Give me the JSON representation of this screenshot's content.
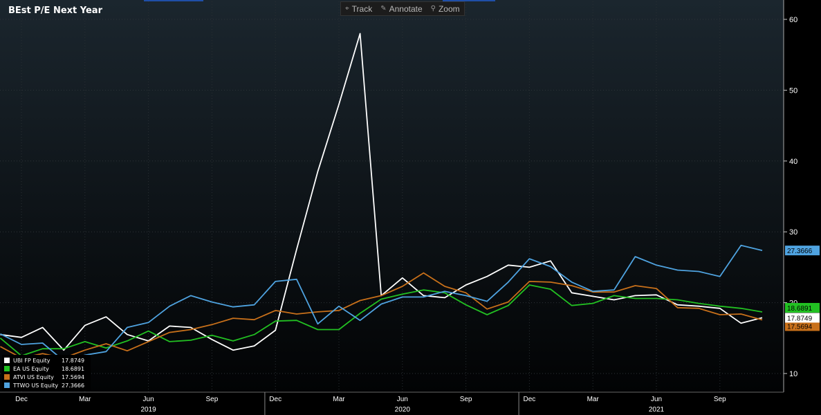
{
  "chart_data": {
    "type": "line",
    "title": "BEst P/E Next Year",
    "ylim": [
      8,
      62
    ],
    "y_ticks": [
      10,
      20,
      30,
      40,
      50,
      60
    ],
    "x_ticks": [
      {
        "label": "Dec",
        "x": 0
      },
      {
        "label": "Mar",
        "x": 3
      },
      {
        "label": "Jun",
        "x": 6
      },
      {
        "label": "Sep",
        "x": 9
      },
      {
        "label": "Dec",
        "x": 12
      },
      {
        "label": "Mar",
        "x": 15
      },
      {
        "label": "Jun",
        "x": 18
      },
      {
        "label": "Sep",
        "x": 21
      },
      {
        "label": "Dec",
        "x": 24
      },
      {
        "label": "Mar",
        "x": 27
      },
      {
        "label": "Jun",
        "x": 30
      },
      {
        "label": "Sep",
        "x": 33
      }
    ],
    "year_labels": [
      {
        "label": "2019",
        "x": 6
      },
      {
        "label": "2020",
        "x": 18
      },
      {
        "label": "2021",
        "x": 30
      }
    ],
    "x": [
      -1,
      0,
      1,
      2,
      3,
      4,
      5,
      6,
      7,
      8,
      9,
      10,
      11,
      12,
      13,
      14,
      15,
      16,
      17,
      18,
      19,
      20,
      21,
      22,
      23,
      24,
      25,
      26,
      27,
      28,
      29,
      30,
      31,
      32,
      33,
      34,
      35
    ],
    "series": [
      {
        "name": "UBI FP Equity",
        "last": "17.8749",
        "color": "#ffffff",
        "values": [
          15.5,
          15.1,
          16.5,
          13.3,
          16.8,
          18.0,
          15.5,
          14.6,
          16.7,
          16.5,
          14.8,
          13.3,
          13.9,
          16.1,
          27.5,
          38.5,
          48.0,
          58.0,
          21.0,
          23.5,
          21.0,
          20.7,
          22.5,
          23.7,
          25.3,
          25.0,
          25.9,
          21.4,
          20.9,
          20.4,
          21.0,
          21.1,
          19.7,
          19.5,
          19.2,
          17.1,
          17.87
        ]
      },
      {
        "name": "EA US Equity",
        "last": "18.6891",
        "color": "#22c022",
        "values": [
          15.0,
          12.5,
          13.5,
          13.5,
          14.5,
          13.6,
          14.6,
          16.0,
          14.5,
          14.7,
          15.4,
          14.6,
          15.5,
          17.4,
          17.5,
          16.2,
          16.2,
          18.5,
          20.5,
          21.2,
          21.8,
          21.4,
          19.7,
          18.3,
          19.6,
          22.5,
          21.9,
          19.6,
          19.9,
          21.0,
          20.6,
          20.6,
          20.4,
          19.9,
          19.5,
          19.2,
          18.69
        ]
      },
      {
        "name": "ATVI US Equity",
        "last": "17.5694",
        "color": "#c8701a",
        "values": [
          13.8,
          12.2,
          12.8,
          12.2,
          13.3,
          14.2,
          13.2,
          14.5,
          15.8,
          16.2,
          16.9,
          17.8,
          17.6,
          18.9,
          18.4,
          18.7,
          18.9,
          20.3,
          21.0,
          22.3,
          24.2,
          22.3,
          21.4,
          19.1,
          20.1,
          23.0,
          22.9,
          22.4,
          21.5,
          21.5,
          22.4,
          22.0,
          19.3,
          19.2,
          18.3,
          18.4,
          17.57
        ]
      },
      {
        "name": "TTWO US Equity",
        "last": "27.3666",
        "color": "#4fa3e0",
        "values": [
          15.6,
          14.1,
          14.3,
          11.8,
          12.6,
          13.1,
          16.5,
          17.2,
          19.5,
          21.0,
          20.1,
          19.4,
          19.7,
          23.0,
          23.3,
          17.0,
          19.5,
          17.5,
          19.8,
          20.8,
          20.8,
          21.6,
          21.0,
          20.2,
          22.9,
          26.2,
          25.1,
          22.9,
          21.6,
          21.8,
          26.5,
          25.3,
          24.6,
          24.4,
          23.7,
          28.1,
          27.37
        ]
      }
    ]
  },
  "toolbar": {
    "track": {
      "icon": "crosshair-icon",
      "label": "Track"
    },
    "annotate": {
      "icon": "pencil-icon",
      "label": "Annotate"
    },
    "zoom": {
      "icon": "magnifier-icon",
      "label": "Zoom"
    }
  },
  "colors": {
    "background_top": "#1a252c",
    "background_bottom": "#000000",
    "grid": "#3a3f44",
    "axis_text": "#ffffff"
  }
}
